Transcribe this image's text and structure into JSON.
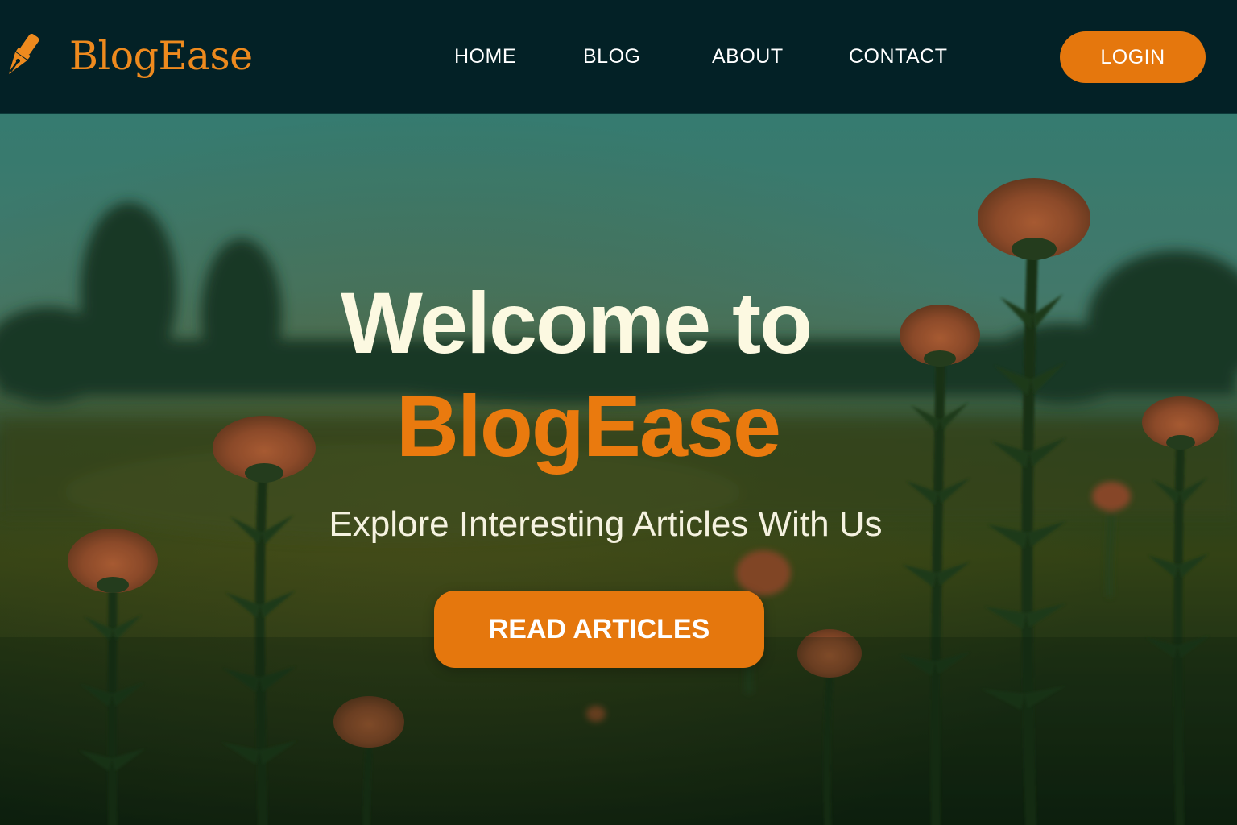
{
  "brand": {
    "name": "BlogEase",
    "icon": "pen-nib-icon"
  },
  "nav": {
    "links": [
      {
        "label": "HOME"
      },
      {
        "label": "BLOG"
      },
      {
        "label": "ABOUT"
      },
      {
        "label": "CONTACT"
      }
    ],
    "login_label": "LOGIN"
  },
  "hero": {
    "title_line1": "Welcome to",
    "title_line2": "BlogEase",
    "subtitle": "Explore Interesting Articles With Us",
    "cta_label": "READ ARTICLES",
    "background": "meadow-with-orange-thistle-flowers"
  },
  "colors": {
    "navbar_bg": "#032126",
    "accent": "#E5770D",
    "brand_text": "#EE8A1E",
    "hero_title": "#FCF9E1",
    "nav_text": "#FFFFFF"
  }
}
